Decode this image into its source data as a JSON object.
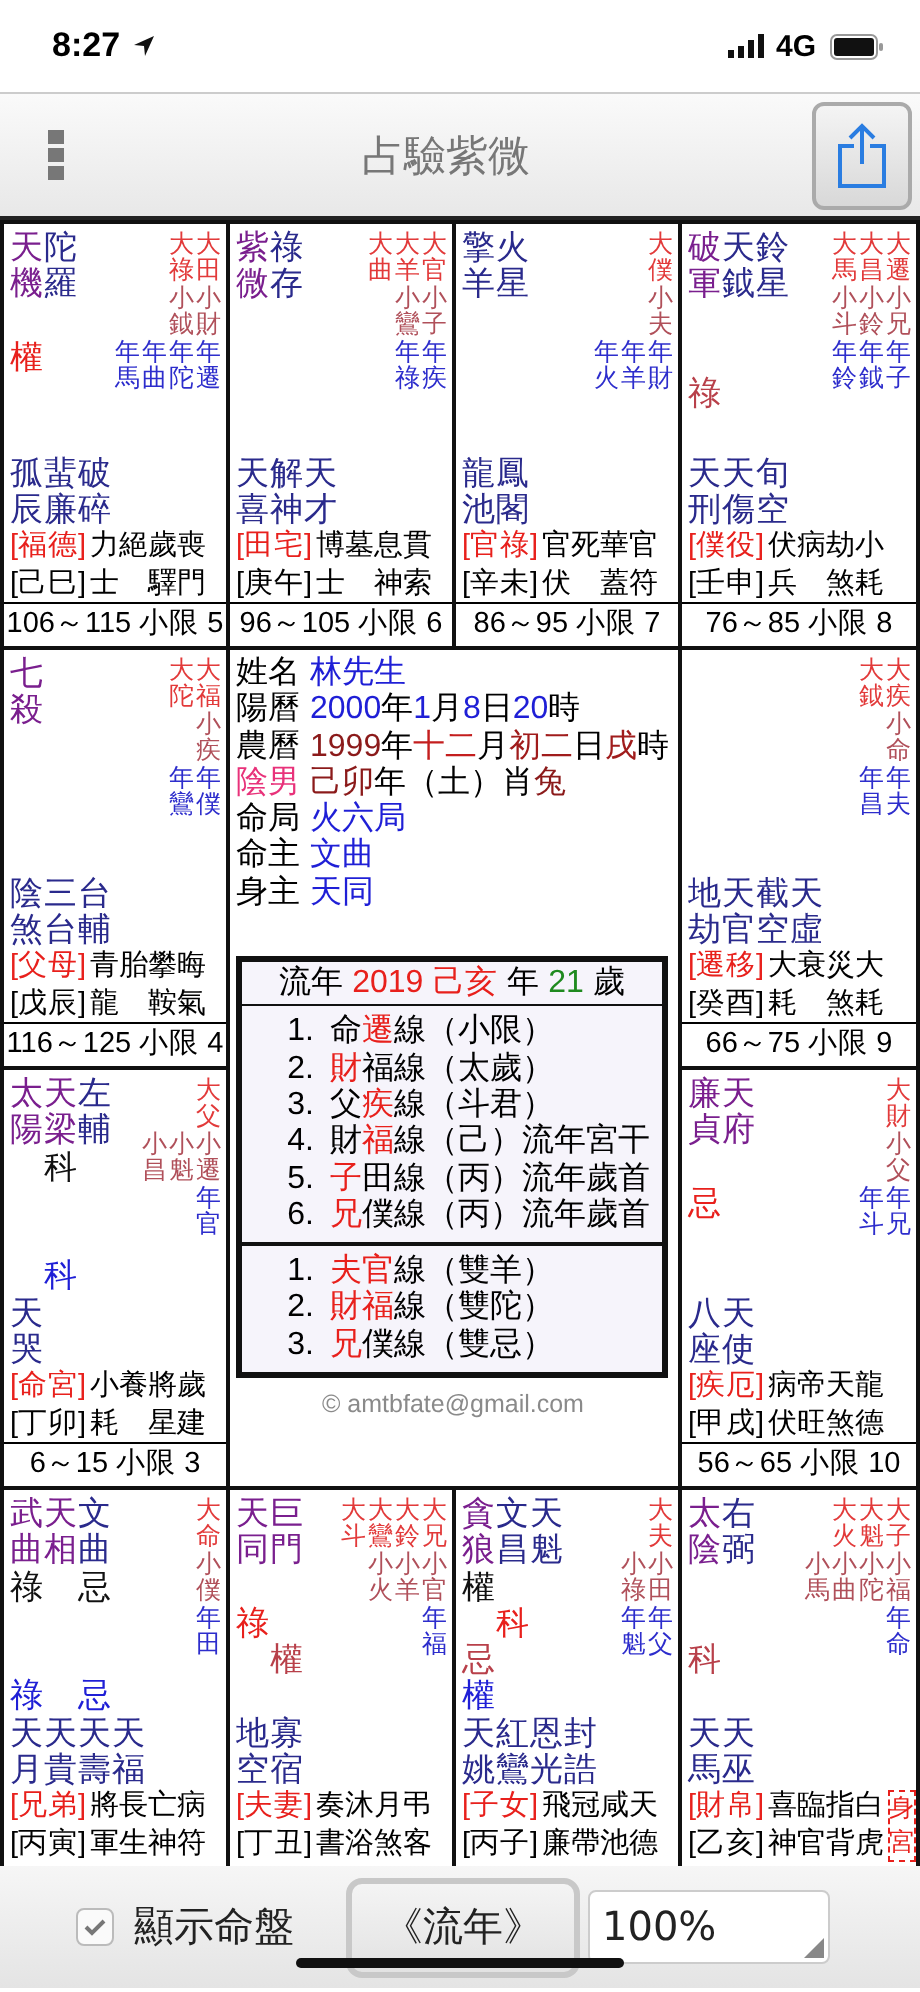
{
  "status_bar": {
    "time": "8:27",
    "network": "4G"
  },
  "nav": {
    "title": "占驗紫微"
  },
  "palaces": [
    {
      "stars": [
        {
          "name": "天機",
          "kind": "major",
          "hua": [
            {
              "text": "權",
              "kind": "decade"
            }
          ]
        },
        {
          "name": "陀羅",
          "kind": "minor"
        }
      ],
      "decade_marks": [
        "大祿",
        "大田"
      ],
      "minor_marks": [
        "小鉞",
        "小財"
      ],
      "year_marks": [
        "年馬",
        "年曲",
        "年陀",
        "年遷"
      ],
      "minor_stars": [
        "孤辰",
        "蜚廉",
        "破碎"
      ],
      "palace": "[福德]",
      "stem": "[己巳]",
      "gods": [
        "力士",
        "絕",
        "歲驛",
        "喪門"
      ],
      "age": "106～115 小限 5"
    },
    {
      "stars": [
        {
          "name": "紫微",
          "kind": "major"
        },
        {
          "name": "祿存",
          "kind": "minor"
        }
      ],
      "decade_marks": [
        "大曲",
        "大羊",
        "大官"
      ],
      "minor_marks": [
        "小鸞",
        "小子"
      ],
      "year_marks": [
        "年祿",
        "年疾"
      ],
      "minor_stars": [
        "天喜",
        "解神",
        "天才"
      ],
      "palace": "[田宅]",
      "stem": "[庚午]",
      "gods": [
        "博士",
        "墓",
        "息神",
        "貫索"
      ],
      "age": "96～105 小限 6"
    },
    {
      "stars": [
        {
          "name": "擎羊",
          "kind": "minor"
        },
        {
          "name": "火星",
          "kind": "minor"
        }
      ],
      "decade_marks": [
        "大僕"
      ],
      "minor_marks": [
        "小夫"
      ],
      "year_marks": [
        "年火",
        "年羊",
        "年財"
      ],
      "minor_stars": [
        "龍池",
        "鳳閣"
      ],
      "palace": "[官祿]",
      "stem": "[辛未]",
      "gods": [
        "官伏",
        "死",
        "華蓋",
        "官符"
      ],
      "age": "86～95 小限 7"
    },
    {
      "stars": [
        {
          "name": "破軍",
          "kind": "major",
          "hua": [
            {
              "text": "祿",
              "kind": "minor"
            }
          ]
        },
        {
          "name": "天鉞",
          "kind": "minor"
        },
        {
          "name": "鈴星",
          "kind": "minor"
        }
      ],
      "decade_marks": [
        "大馬",
        "大昌",
        "大遷"
      ],
      "minor_marks": [
        "小斗",
        "小鈴",
        "小兄"
      ],
      "year_marks": [
        "年鈴",
        "年鉞",
        "年子"
      ],
      "minor_stars": [
        "天刑",
        "天傷",
        "旬空"
      ],
      "palace": "[僕役]",
      "stem": "[壬申]",
      "gods": [
        "伏兵",
        "病",
        "劫煞",
        "小耗"
      ],
      "age": "76～85 小限 8"
    },
    {
      "stars": [
        {
          "name": "七殺",
          "kind": "major"
        }
      ],
      "decade_marks": [
        "大陀",
        "大福"
      ],
      "minor_marks": [
        "小疾"
      ],
      "year_marks": [
        "年鸞",
        "年僕"
      ],
      "minor_stars": [
        "陰煞",
        "三台",
        "台輔"
      ],
      "palace": "[父母]",
      "stem": "[戊辰]",
      "gods": [
        "青龍",
        "胎",
        "攀鞍",
        "晦氣"
      ],
      "age": "116～125 小限 4"
    },
    {
      "decade_marks": [
        "大鉞",
        "大疾"
      ],
      "minor_marks": [
        "小命"
      ],
      "year_marks": [
        "年昌",
        "年夫"
      ],
      "minor_stars": [
        "地劫",
        "天官",
        "截空",
        "天虛"
      ],
      "palace": "[遷移]",
      "stem": "[癸酉]",
      "gods": [
        "大耗",
        "衰",
        "災煞",
        "大耗"
      ],
      "age": "66～75 小限 9"
    },
    {
      "stars": [
        {
          "name": "太陽",
          "kind": "major"
        },
        {
          "name": "天梁",
          "kind": "major",
          "hua": [
            {
              "text": "科",
              "kind": "natal"
            },
            {
              "text": "科",
              "kind": "year"
            }
          ]
        },
        {
          "name": "左輔",
          "kind": "minor"
        }
      ],
      "decade_marks": [
        "大父"
      ],
      "minor_marks": [
        "小昌",
        "小魁",
        "小遷"
      ],
      "year_marks": [
        "年官"
      ],
      "minor_stars": [
        "天哭"
      ],
      "palace": "[命宮]",
      "stem": "[丁卯]",
      "gods": [
        "小耗",
        "養",
        "將星",
        "歲建"
      ],
      "age": "6～15 小限 3"
    },
    {
      "stars": [
        {
          "name": "廉貞",
          "kind": "major",
          "hua": [
            {
              "text": "忌",
              "kind": "decade"
            }
          ]
        },
        {
          "name": "天府",
          "kind": "major"
        }
      ],
      "decade_marks": [
        "大財"
      ],
      "minor_marks": [
        "小父"
      ],
      "year_marks": [
        "年斗",
        "年兄"
      ],
      "minor_stars": [
        "八座",
        "天使"
      ],
      "palace": "[疾厄]",
      "stem": "[甲戌]",
      "gods": [
        "病伏",
        "帝旺",
        "天煞",
        "龍德"
      ],
      "age": "56～65 小限 10"
    },
    {
      "stars": [
        {
          "name": "武曲",
          "kind": "major",
          "hua": [
            {
              "text": "祿",
              "kind": "natal"
            },
            {
              "text": "祿",
              "kind": "year"
            }
          ]
        },
        {
          "name": "天相",
          "kind": "major"
        },
        {
          "name": "文曲",
          "kind": "minor",
          "hua": [
            {
              "text": "忌",
              "kind": "natal"
            },
            {
              "text": "忌",
              "kind": "year"
            }
          ]
        }
      ],
      "decade_marks": [
        "大命"
      ],
      "minor_marks": [
        "小僕"
      ],
      "year_marks": [
        "年田"
      ],
      "minor_stars": [
        "天月",
        "天貴",
        "天壽",
        "天福"
      ],
      "palace": "[兄弟]",
      "stem": "[丙寅]",
      "gods": [
        "將軍",
        "長生",
        "亡神",
        "病符"
      ]
    },
    {
      "stars": [
        {
          "name": "天同",
          "kind": "major",
          "hua": [
            {
              "text": "祿",
              "kind": "decade"
            }
          ]
        },
        {
          "name": "巨門",
          "kind": "major",
          "hua": [
            {
              "text": "權",
              "kind": "minor"
            }
          ]
        }
      ],
      "decade_marks": [
        "大斗",
        "大鸞",
        "大鈴",
        "大兄"
      ],
      "minor_marks": [
        "小火",
        "小羊",
        "小官"
      ],
      "year_marks": [
        "年福"
      ],
      "minor_stars": [
        "地空",
        "寡宿"
      ],
      "palace": "[夫妻]",
      "stem": "[丁丑]",
      "gods": [
        "奏書",
        "沐浴",
        "月煞",
        "弔客"
      ]
    },
    {
      "stars": [
        {
          "name": "貪狼",
          "kind": "major",
          "hua": [
            {
              "text": "權",
              "kind": "natal"
            },
            {
              "text": "忌",
              "kind": "minor"
            },
            {
              "text": "權",
              "kind": "year"
            }
          ]
        },
        {
          "name": "文昌",
          "kind": "minor",
          "hua": [
            {
              "text": "科",
              "kind": "decade"
            }
          ]
        },
        {
          "name": "天魁",
          "kind": "minor"
        }
      ],
      "decade_marks": [
        "大夫"
      ],
      "minor_marks": [
        "小祿",
        "小田"
      ],
      "year_marks": [
        "年魁",
        "年父"
      ],
      "minor_stars": [
        "天姚",
        "紅鸞",
        "恩光",
        "封誥"
      ],
      "palace": "[子女]",
      "stem": "[丙子]",
      "gods": [
        "飛廉",
        "冠帶",
        "咸池",
        "天德"
      ]
    },
    {
      "stars": [
        {
          "name": "太陰",
          "kind": "major",
          "hua": [
            {
              "text": "科",
              "kind": "minor"
            }
          ]
        },
        {
          "name": "右弼",
          "kind": "minor"
        }
      ],
      "decade_marks": [
        "大火",
        "大魁",
        "大子"
      ],
      "minor_marks": [
        "小馬",
        "小曲",
        "小陀",
        "小福"
      ],
      "year_marks": [
        "年命"
      ],
      "minor_stars": [
        "天馬",
        "天巫"
      ],
      "palace": "[財帛]",
      "stem": "[乙亥]",
      "gods": [
        "喜神",
        "臨官",
        "指背",
        "白虎"
      ],
      "body_badge": "身宮"
    }
  ],
  "center": {
    "info": [
      {
        "label": {
          "text": "姓名"
        },
        "parts": [
          {
            "text": "林先生",
            "color": "#1f1fd6"
          }
        ]
      },
      {
        "label": {
          "text": "陽曆"
        },
        "parts": [
          {
            "text": "2000",
            "color": "#1f1fd6"
          },
          {
            "text": "年"
          },
          {
            "text": "1",
            "color": "#1f1fd6"
          },
          {
            "text": "月"
          },
          {
            "text": "8",
            "color": "#1f1fd6"
          },
          {
            "text": "日"
          },
          {
            "text": "20",
            "color": "#1f1fd6"
          },
          {
            "text": "時"
          }
        ]
      },
      {
        "label": {
          "text": "農曆"
        },
        "parts": [
          {
            "text": "1999",
            "color": "#8b1a1a"
          },
          {
            "text": "年"
          },
          {
            "text": "十二",
            "color": "#c41e1e"
          },
          {
            "text": "月"
          },
          {
            "text": "初二",
            "color": "#a01c1c"
          },
          {
            "text": "日"
          },
          {
            "text": "戌",
            "color": "#a01c1c"
          },
          {
            "text": "時"
          }
        ]
      },
      {
        "label": {
          "text": "陰男",
          "color": "#e8327a"
        },
        "parts": [
          {
            "text": "己卯",
            "color": "#8b1a1a"
          },
          {
            "text": "年（土）肖"
          },
          {
            "text": "兔",
            "color": "#8b1a1a"
          }
        ]
      },
      {
        "label": {
          "text": "命局"
        },
        "parts": [
          {
            "text": "火六局",
            "color": "#1f1fd6"
          }
        ]
      },
      {
        "label": {
          "text": "命主"
        },
        "parts": [
          {
            "text": "文曲",
            "color": "#1f1fd6"
          }
        ]
      },
      {
        "label": {
          "text": "身主"
        },
        "parts": [
          {
            "text": "天同",
            "color": "#1f1fd6"
          }
        ]
      }
    ],
    "annual": {
      "header": [
        {
          "text": "流年"
        },
        {
          "text": "2019",
          "color": "#e8201c"
        },
        {
          "text": "己亥",
          "color": "#e8201c"
        },
        {
          "text": "年"
        },
        {
          "text": "21",
          "color": "#1f8a1f"
        },
        {
          "text": "歲"
        }
      ],
      "lines_a": [
        {
          "number": "1.",
          "parts": [
            {
              "text": "命"
            },
            {
              "text": "遷",
              "color": "#e8201c"
            },
            {
              "text": "線（小限）"
            }
          ]
        },
        {
          "number": "2.",
          "parts": [
            {
              "text": "財",
              "color": "#e8201c"
            },
            {
              "text": "福線（太歲）"
            }
          ]
        },
        {
          "number": "3.",
          "parts": [
            {
              "text": "父"
            },
            {
              "text": "疾",
              "color": "#e8201c"
            },
            {
              "text": "線（斗君）"
            }
          ]
        },
        {
          "number": "4.",
          "parts": [
            {
              "text": "財"
            },
            {
              "text": "福",
              "color": "#e8201c"
            },
            {
              "text": "線（己）流年宮干"
            }
          ]
        },
        {
          "number": "5.",
          "parts": [
            {
              "text": "子",
              "color": "#e8201c"
            },
            {
              "text": "田線（丙）流年歲首"
            }
          ]
        },
        {
          "number": "6.",
          "parts": [
            {
              "text": "兄",
              "color": "#e8201c"
            },
            {
              "text": "僕線（丙）流年歲首"
            }
          ]
        }
      ],
      "lines_b": [
        {
          "number": "1.",
          "parts": [
            {
              "text": "夫官",
              "color": "#e8201c"
            },
            {
              "text": "線（雙羊）"
            }
          ]
        },
        {
          "number": "2.",
          "parts": [
            {
              "text": "財福",
              "color": "#e8201c"
            },
            {
              "text": "線（雙陀）"
            }
          ]
        },
        {
          "number": "3.",
          "parts": [
            {
              "text": "兄",
              "color": "#e8201c"
            },
            {
              "text": "僕線（雙忌）"
            }
          ]
        }
      ]
    },
    "credit": "© amtbfate@gmail.com"
  },
  "footer": {
    "show_chart": {
      "label": "顯示命盤",
      "checked": true
    },
    "mode_button": "《流年》",
    "zoom": "100%"
  }
}
